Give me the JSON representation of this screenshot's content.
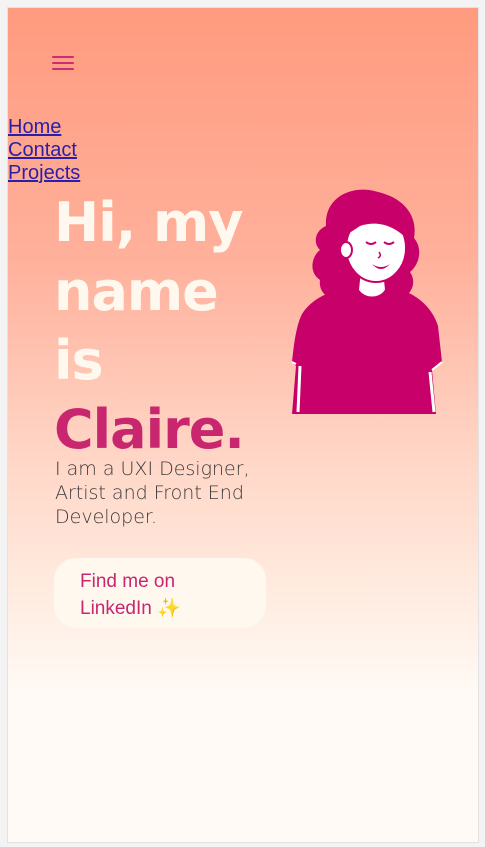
{
  "nav": {
    "menu_icon": "hamburger-menu-icon",
    "links": [
      "Home",
      "Contact",
      "Projects"
    ]
  },
  "hero": {
    "heading_lines": [
      "Hi, my",
      "name",
      "is"
    ],
    "name": "Claire.",
    "tagline": "I am a UXI Designer, Artist and Front End Developer.",
    "cta_label": "Find me on LinkedIn ✨",
    "illustration_icon": "woman-avatar-illustration"
  },
  "colors": {
    "accent": "#c8266f",
    "cream": "#fff8ef",
    "gradient_top": "#ff9b7f",
    "link": "#2a1fa6"
  }
}
